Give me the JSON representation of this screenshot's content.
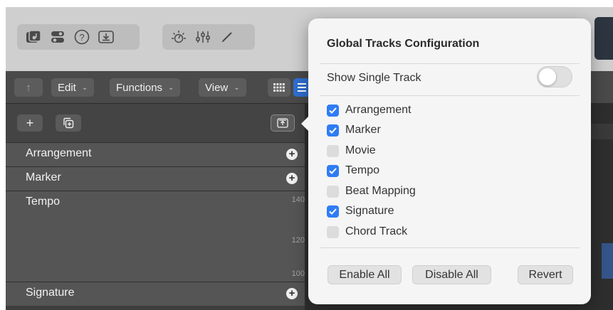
{
  "toolbar": {
    "icons": [
      "library-icon",
      "toggles-icon",
      "help-icon",
      "download-icon",
      "metronome-icon",
      "mixer-icon",
      "pencil-icon"
    ],
    "help_glyph": "?"
  },
  "menubar": {
    "edit_label": "Edit",
    "functions_label": "Functions",
    "view_label": "View",
    "back_glyph": "↑"
  },
  "left_panel": {
    "add_glyph": "+",
    "tracks": [
      {
        "name": "Arrangement"
      },
      {
        "name": "Marker"
      },
      {
        "name": "Tempo",
        "ticks": [
          "140",
          "120",
          "100"
        ]
      },
      {
        "name": "Signature"
      }
    ],
    "add_track_glyph": "+"
  },
  "popover": {
    "title": "Global Tracks Configuration",
    "show_single_track_label": "Show Single Track",
    "show_single_track_on": false,
    "tracks": [
      {
        "label": "Arrangement",
        "checked": true
      },
      {
        "label": "Marker",
        "checked": true
      },
      {
        "label": "Movie",
        "checked": false
      },
      {
        "label": "Tempo",
        "checked": true
      },
      {
        "label": "Beat Mapping",
        "checked": false
      },
      {
        "label": "Signature",
        "checked": true
      },
      {
        "label": "Chord Track",
        "checked": false
      }
    ],
    "enable_all_label": "Enable All",
    "disable_all_label": "Disable All",
    "revert_label": "Revert"
  },
  "colors": {
    "accent": "#2f7cf6",
    "toolbar_bg": "#cfcfcf",
    "panel_bg": "#3e3e3e",
    "popover_bg": "#f5f5f5"
  }
}
